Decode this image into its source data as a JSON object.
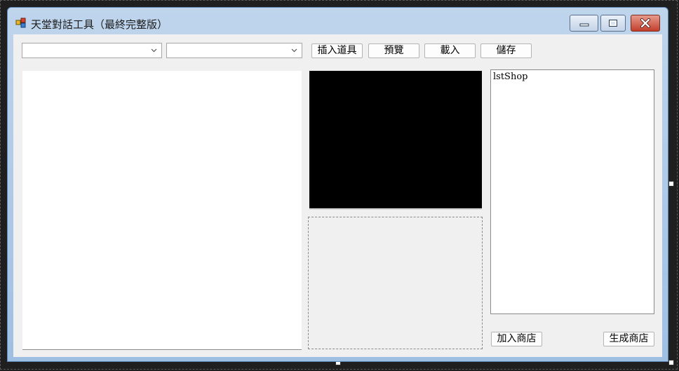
{
  "window": {
    "title": "天堂對話工具（最終完整版）"
  },
  "toolbar": {
    "combo1_value": "",
    "combo2_value": "",
    "insert_item_label": "插入道具",
    "preview_label": "預覽",
    "load_label": "載入",
    "save_label": "儲存"
  },
  "shop": {
    "list_placeholder": "lstShop",
    "add_label": "加入商店",
    "generate_label": "生成商店"
  },
  "colors": {
    "client_bg": "#f0f0f0",
    "preview_bg": "#000000",
    "close_button": "#c2402c"
  }
}
